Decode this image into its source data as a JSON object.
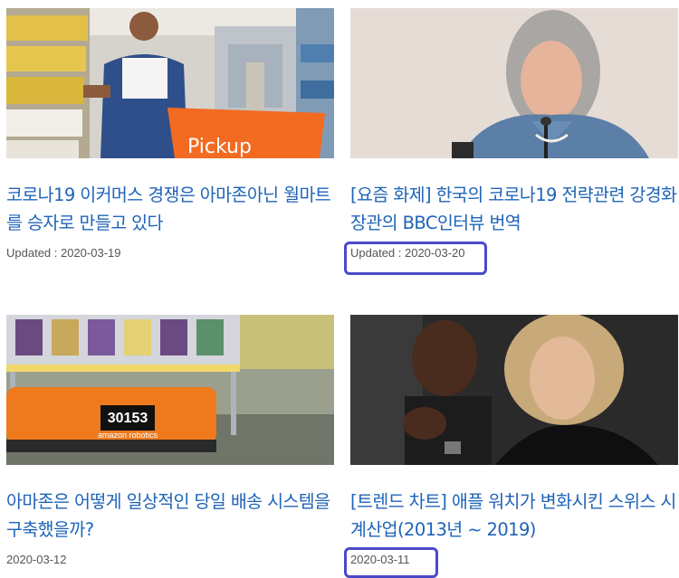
{
  "articles": [
    {
      "title": "코로나19 이커머스 경쟁은 아마존아닌 월마트를 승자로 만들고 있다",
      "date": "Updated : 2020-03-19",
      "image_desc": "walmart-store-pickup-cart",
      "badge": "Pickup"
    },
    {
      "title": "[요즘 화제] 한국의 코로나19 전략관련 강경화장관의 BBC인터뷰 번역",
      "date": "Updated : 2020-03-20",
      "image_desc": "minister-speaking-at-microphone"
    },
    {
      "title": "아마존은 어떻게 일상적인 당일 배송 시스템을 구축했을까?",
      "date": "2020-03-12",
      "image_desc": "amazon-robotics-warehouse-robot",
      "robot_number": "30153",
      "robot_brand": "amazon robotics"
    },
    {
      "title": "[트렌드 차트] 애플 워치가 변화시킨 스위스 시계산업(2013년 ~ 2019)",
      "date": "2020-03-11",
      "image_desc": "couple-portrait-with-smartwatch"
    }
  ],
  "colors": {
    "title": "#1f64b8",
    "highlight": "#4b49c8",
    "date": "#555555"
  }
}
